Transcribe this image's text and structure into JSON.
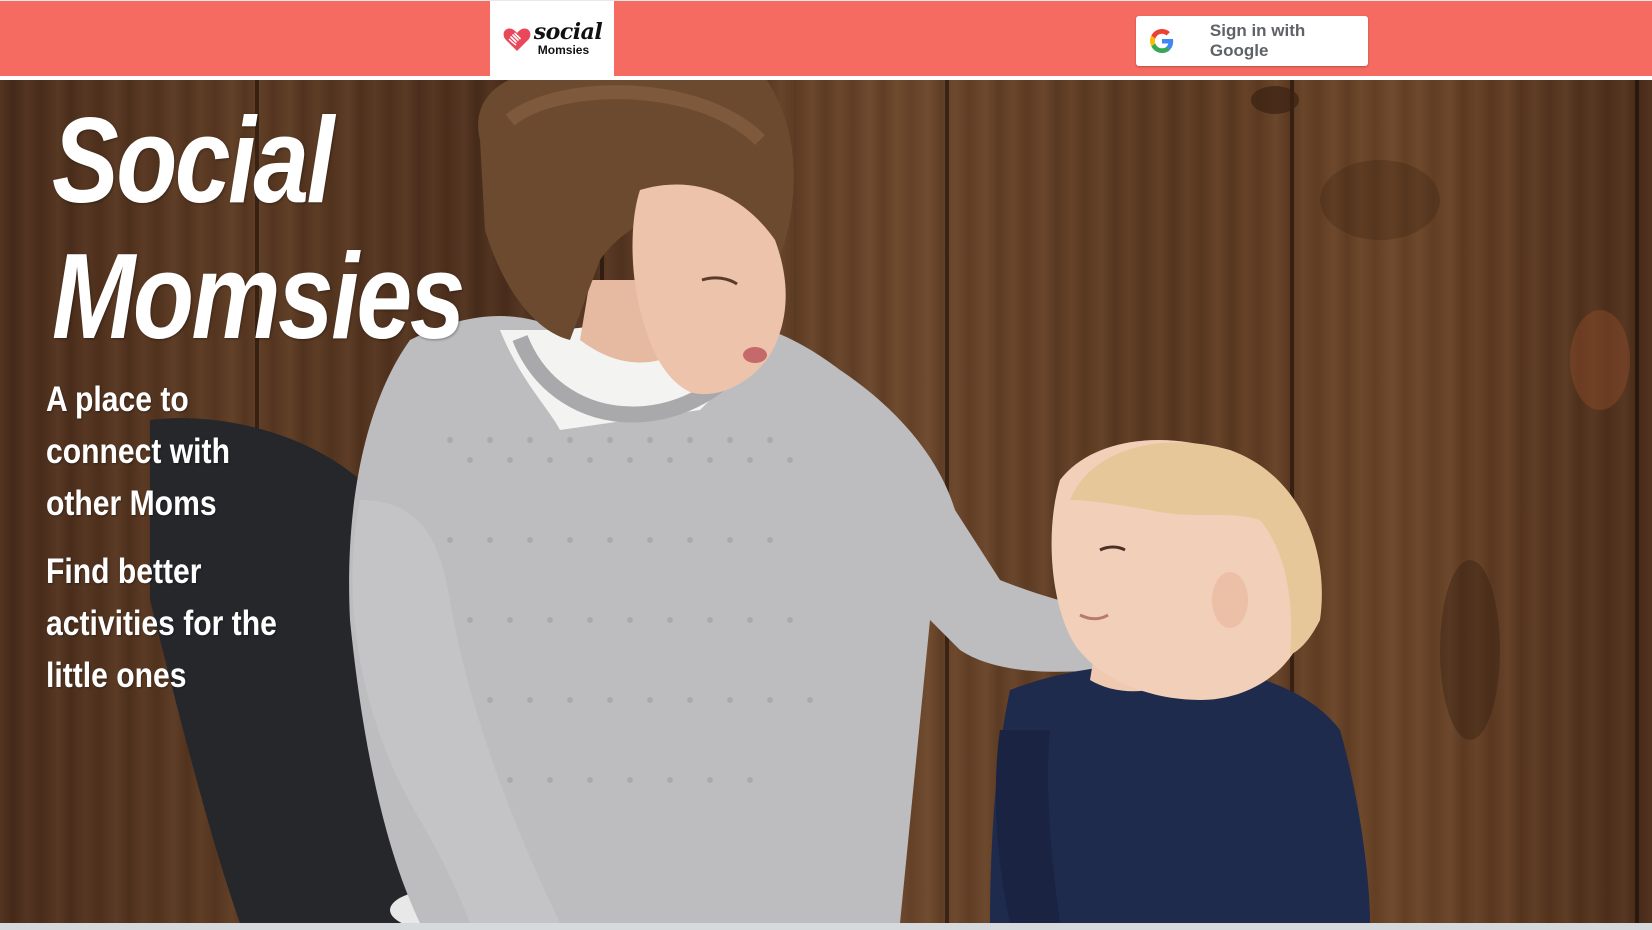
{
  "header": {
    "logo": {
      "word_social": "social",
      "word_momsies": "Momsies",
      "icon": "heart-hands-icon"
    },
    "signin_button": {
      "label": "Sign in with Google",
      "icon": "google-g-icon"
    },
    "bar_color": "#f56b61"
  },
  "hero": {
    "title_line1": "Social",
    "title_line2": "Momsies",
    "tagline1": "A place to connect with other Moms",
    "tagline2": "Find better activities for the little ones",
    "image": "mother-and-child-photo"
  }
}
